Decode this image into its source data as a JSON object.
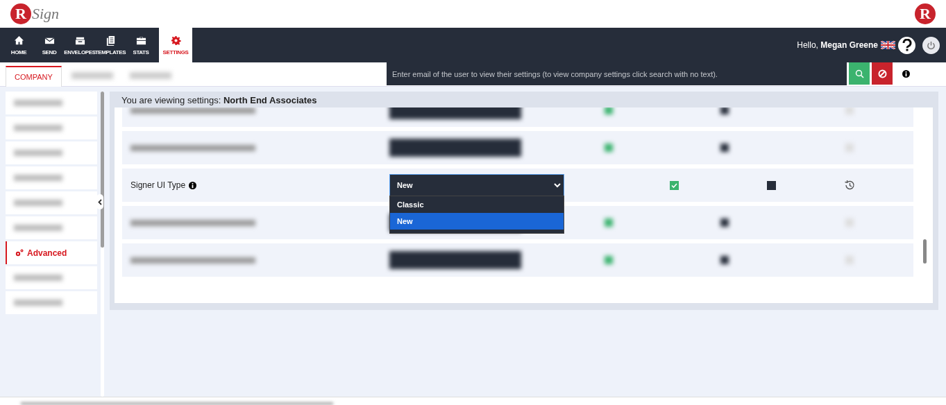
{
  "logo": {
    "letter": "R",
    "word": "Sign"
  },
  "corner_logo": {
    "letter": "R"
  },
  "nav": [
    {
      "label": "HOME",
      "selected": false
    },
    {
      "label": "SEND",
      "selected": false
    },
    {
      "label": "ENVELOPES",
      "selected": false
    },
    {
      "label": "TEMPLATES",
      "selected": false
    },
    {
      "label": "STATS",
      "selected": false
    },
    {
      "label": "SETTINGS",
      "selected": true
    }
  ],
  "user": {
    "greeting": "Hello,",
    "name": "Megan Greene"
  },
  "tabs": [
    {
      "kind": "tab",
      "label": "COMPANY",
      "selected": true
    },
    {
      "kind": "blurred"
    },
    {
      "kind": "blurred"
    }
  ],
  "search": {
    "placeholder": "Enter email of the user to view their settings (to view company settings click search with no text)."
  },
  "sidebar": {
    "items": [
      {
        "kind": "blurred"
      },
      {
        "kind": "blurred"
      },
      {
        "kind": "blurred"
      },
      {
        "kind": "blurred"
      },
      {
        "kind": "blurred"
      },
      {
        "kind": "blurred"
      },
      {
        "kind": "item",
        "label": "Advanced",
        "selected": true
      },
      {
        "kind": "blurred"
      },
      {
        "kind": "blurred"
      }
    ]
  },
  "panel": {
    "heading": "You are viewing settings:",
    "company": "North End Associates"
  },
  "rows": [
    {
      "kind": "blurred"
    },
    {
      "kind": "blurred"
    },
    {
      "kind": "setting",
      "label": "Signer UI Type",
      "value": "New",
      "expanded": true,
      "options": [
        {
          "label": "Classic",
          "selected": false
        },
        {
          "label": "New",
          "selected": true
        }
      ],
      "enabled": true,
      "locked": false
    },
    {
      "kind": "blurred"
    },
    {
      "kind": "blurred"
    }
  ]
}
